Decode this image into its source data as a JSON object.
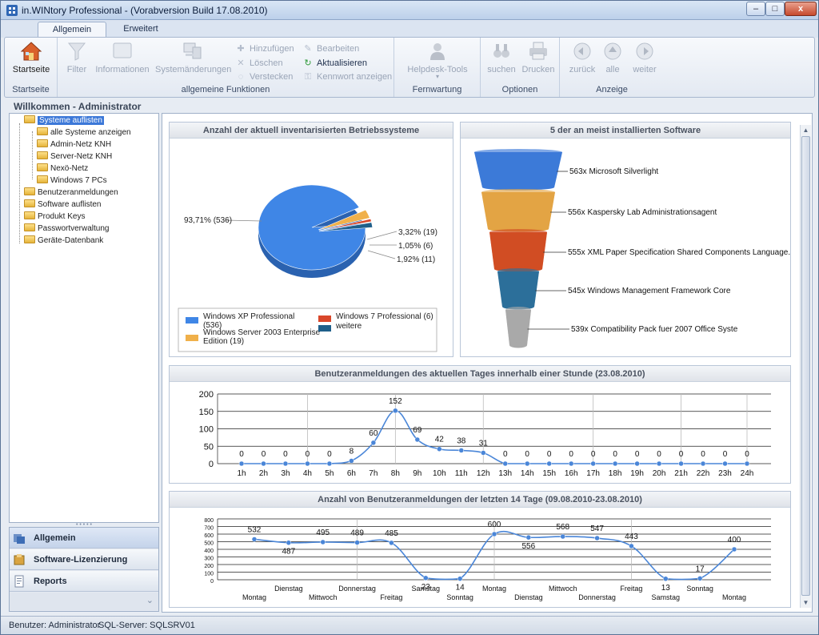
{
  "window": {
    "title": "in.WINtory Professional - (Vorabversion Build 17.08.2010)",
    "controls": {
      "minimize": "–",
      "maximize": "□",
      "close": "x"
    }
  },
  "tabs": [
    {
      "label": "Allgemein",
      "active": true
    },
    {
      "label": "Erweitert",
      "active": false
    }
  ],
  "ribbon": {
    "groups": {
      "startseite": {
        "label": "Startseite",
        "button": "Startseite"
      },
      "allgemein": {
        "label": "allgemeine Funktionen",
        "large": [
          "Filter",
          "Informationen",
          "Systemänderungen"
        ],
        "small": [
          "Hinzufügen",
          "Löschen",
          "Verstecken",
          "Bearbeiten",
          "Aktualisieren",
          "Kennwort anzeigen"
        ]
      },
      "fernwartung": {
        "label": "Fernwartung",
        "button": "Helpdesk-Tools"
      },
      "optionen": {
        "label": "Optionen",
        "buttons": [
          "suchen",
          "Drucken"
        ]
      },
      "anzeige": {
        "label": "Anzeige",
        "buttons": [
          "zurück",
          "alle",
          "weiter"
        ]
      }
    }
  },
  "welcome": "Willkommen - Administrator",
  "tree": {
    "items": [
      {
        "label": "Systeme auflisten",
        "level": 0,
        "selected": true
      },
      {
        "label": "alle Systeme anzeigen",
        "level": 1
      },
      {
        "label": "Admin-Netz KNH",
        "level": 1
      },
      {
        "label": "Server-Netz KNH",
        "level": 1
      },
      {
        "label": "Nexö-Netz",
        "level": 1
      },
      {
        "label": "Windows 7 PCs",
        "level": 1
      },
      {
        "label": "Benutzeranmeldungen",
        "level": 0
      },
      {
        "label": "Software auflisten",
        "level": 0
      },
      {
        "label": "Produkt Keys",
        "level": 0
      },
      {
        "label": "Passwortverwaltung",
        "level": 0
      },
      {
        "label": "Geräte-Datenbank",
        "level": 0
      }
    ]
  },
  "nav": {
    "buttons": [
      {
        "label": "Allgemein",
        "active": true
      },
      {
        "label": "Software-Lizenzierung",
        "active": false
      },
      {
        "label": "Reports",
        "active": false
      }
    ],
    "chevron": "⌄"
  },
  "status": {
    "user": "Benutzer: Administrator",
    "sql": "SQL-Server: SQLSRV01"
  },
  "chart_data": [
    {
      "type": "pie",
      "title": "Anzahl der aktuell inventarisierten Betriebssysteme",
      "slices": [
        {
          "name": "Windows XP Professional (536)",
          "value": 536,
          "label": "93,71% (536)",
          "color": "#3f86e6"
        },
        {
          "name": "Windows Server 2003 Enterprise Edition (19)",
          "value": 19,
          "label": "3,32% (19)",
          "color": "#f0b04a"
        },
        {
          "name": "Windows 7 Professional (6)",
          "value": 6,
          "label": "1,05% (6)",
          "color": "#d9472a"
        },
        {
          "name": "weitere",
          "value": 11,
          "label": "1,92% (11)",
          "color": "#1f5f8a"
        }
      ],
      "legend_position": "bottom"
    },
    {
      "type": "funnel",
      "title": "5 der an meist installierten Software",
      "items": [
        {
          "label": "563x Microsoft Silverlight",
          "value": 563,
          "color": "#3c7ad8"
        },
        {
          "label": "556x Kaspersky Lab Administrationsagent",
          "value": 556,
          "color": "#e3a444"
        },
        {
          "label": "555x XML Paper Specification Shared Components Language..",
          "value": 555,
          "color": "#d14d23"
        },
        {
          "label": "545x Windows Management Framework Core",
          "value": 545,
          "color": "#2c6f9a"
        },
        {
          "label": "539x Compatibility Pack fuer 2007 Office Syste",
          "value": 539,
          "color": "#a9a9a9"
        }
      ]
    },
    {
      "type": "line",
      "title": "Benutzeranmeldungen des aktuellen Tages innerhalb einer Stunde (23.08.2010)",
      "categories": [
        "1h",
        "2h",
        "3h",
        "4h",
        "5h",
        "6h",
        "7h",
        "8h",
        "9h",
        "10h",
        "11h",
        "12h",
        "13h",
        "14h",
        "15h",
        "16h",
        "17h",
        "18h",
        "19h",
        "20h",
        "21h",
        "22h",
        "23h",
        "24h"
      ],
      "values": [
        0,
        0,
        0,
        0,
        0,
        8,
        60,
        152,
        69,
        42,
        38,
        31,
        0,
        0,
        0,
        0,
        0,
        0,
        0,
        0,
        0,
        0,
        0,
        0
      ],
      "ylim": [
        0,
        200
      ],
      "yticks": [
        0,
        50,
        100,
        150,
        200
      ],
      "grid": true,
      "color": "#4a86d8"
    },
    {
      "type": "line",
      "title": "Anzahl von Benutzeranmeldungen der letzten 14 Tage  (09.08.2010-23.08.2010)",
      "categories": [
        "Montag",
        "Dienstag",
        "Mittwoch",
        "Donnerstag",
        "Freitag",
        "Samstag",
        "Sonntag",
        "Montag",
        "Dienstag",
        "Mittwoch",
        "Donnerstag",
        "Freitag",
        "Samstag",
        "Sonntag",
        "Montag"
      ],
      "values": [
        532,
        487,
        495,
        489,
        485,
        23,
        14,
        600,
        556,
        568,
        547,
        443,
        13,
        17,
        400
      ],
      "ylim": [
        0,
        800
      ],
      "yticks": [
        0,
        100,
        200,
        300,
        400,
        500,
        600,
        700,
        800
      ],
      "grid": true,
      "color": "#4a86d8"
    }
  ]
}
